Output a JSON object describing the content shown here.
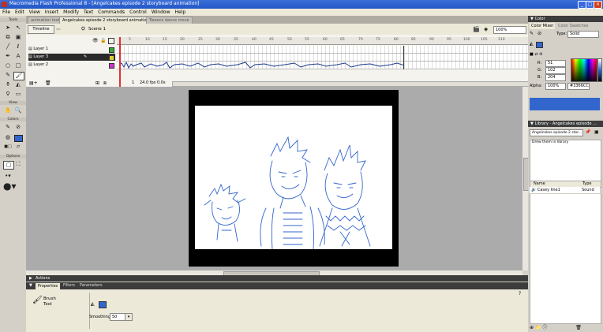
{
  "window": {
    "title": "Macromedia Flash Professional 8 - [Angelcakes episode 2 storyboard animation]"
  },
  "menu": [
    "File",
    "Edit",
    "View",
    "Insert",
    "Modify",
    "Text",
    "Commands",
    "Control",
    "Window",
    "Help"
  ],
  "tools_panel": {
    "title": "Tools",
    "view": "View",
    "colors": "Colors",
    "options": "Options"
  },
  "doc_tabs": [
    "animation test",
    "Angelcakes episode 2 storyboard animation",
    "Tweens dance move"
  ],
  "timeline": {
    "button": "Timeline",
    "scene": "Scene 1",
    "zoom": "100%",
    "layers": [
      {
        "name": "Layer 1"
      },
      {
        "name": "Layer 3"
      },
      {
        "name": "Layer 2"
      }
    ],
    "ruler": [
      "5",
      "10",
      "15",
      "20",
      "25",
      "30",
      "35",
      "40",
      "45",
      "50",
      "55",
      "60",
      "65",
      "70",
      "75",
      "80",
      "85",
      "90",
      "95",
      "100",
      "105",
      "110"
    ],
    "frame": "1",
    "fps": "24.0 fps",
    "time": "0.0s"
  },
  "bottom_tabs": {
    "actions": "Actions",
    "properties": "Properties",
    "filters": "Filters",
    "parameters": "Parameters"
  },
  "properties": {
    "tool_name": "Brush",
    "tool_sub": "Tool",
    "smoothing_label": "Smoothing:",
    "smoothing_value": "50"
  },
  "color_panel": {
    "title": "Color",
    "tabs": [
      "Color Mixer",
      "Color Swatches"
    ],
    "type_label": "Type:",
    "type_value": "Solid",
    "r_label": "R:",
    "r": "51",
    "g_label": "G:",
    "g": "102",
    "b_label": "B:",
    "b": "204",
    "alpha_label": "Alpha:",
    "alpha": "100%",
    "hex": "#3366CC",
    "swatch_color": "#3366cc"
  },
  "library_panel": {
    "title": "Library - Angelcakes episode ...",
    "doc": "Angelcakes episode 2 stor...",
    "hint": "Drew them in library",
    "col_name": "Name",
    "col_type": "Type",
    "item_name": "Casey line1",
    "item_type": "Sound"
  },
  "colors": {
    "stroke": "#3366cc",
    "titlebar": "#2256c8",
    "panel_header": "#3c3c3c"
  }
}
